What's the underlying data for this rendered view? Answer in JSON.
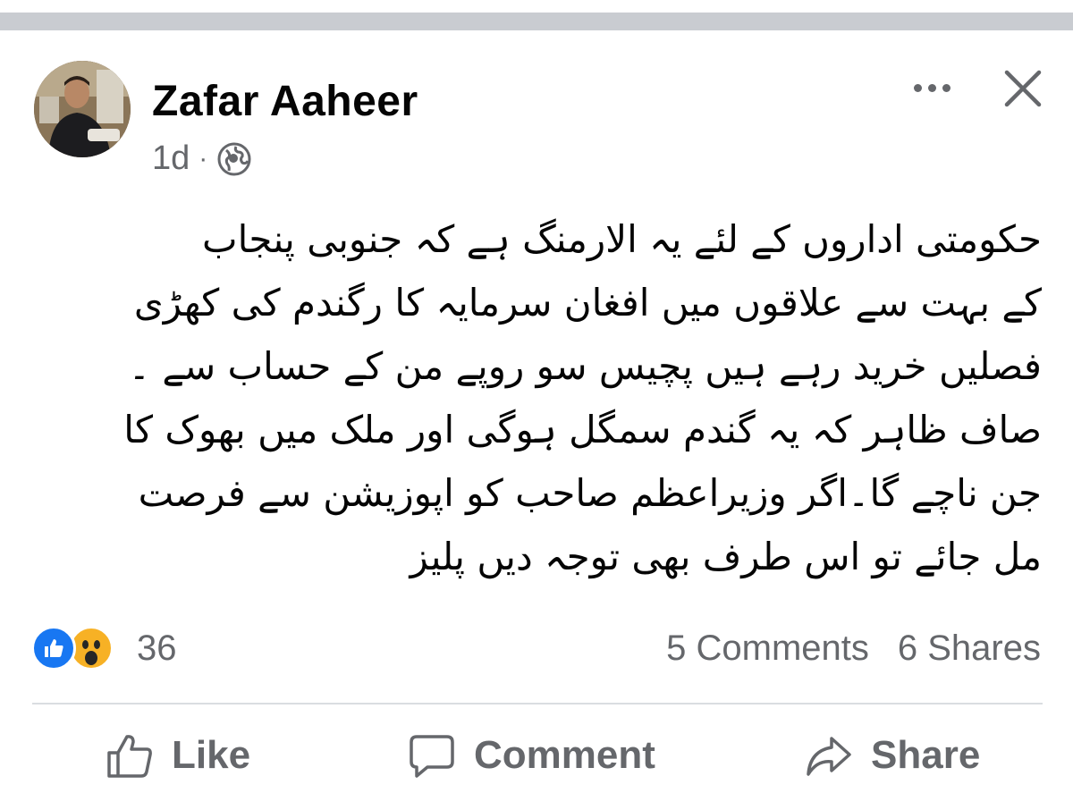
{
  "post": {
    "author": "Zafar Aaheer",
    "time": "1d",
    "separator": "·",
    "privacy_icon": "globe-icon",
    "text_lines": [
      "حکومتی اداروں کے لئے یہ الارمنگ ہے کہ جنوبی پنجاب",
      "کے بہت سے علاقوں میں افغان سرمایہ کا رگندم کی کھڑی",
      "فصلیں خرید رہے ہیں پچیس سو روپے من کے حساب سے ۔",
      "صاف ظاہر کہ یہ گندم سمگل ہوگی اور ملک میں بھوک کا",
      "جن ناچے گا۔اگر وزیراعظم صاحب کو اپوزیشن سے فرصت",
      "مل جائے تو اس طرف بھی توجہ دیں پلیز"
    ]
  },
  "stats": {
    "reaction_count": "36",
    "comments": "5 Comments",
    "shares": "6 Shares"
  },
  "actions": {
    "like": "Like",
    "comment": "Comment",
    "share": "Share"
  },
  "colors": {
    "divider": "#c9ccd1",
    "secondary_text": "#65676b",
    "like_blue": "#1877f2",
    "wow_yellow": "#f7b125"
  }
}
